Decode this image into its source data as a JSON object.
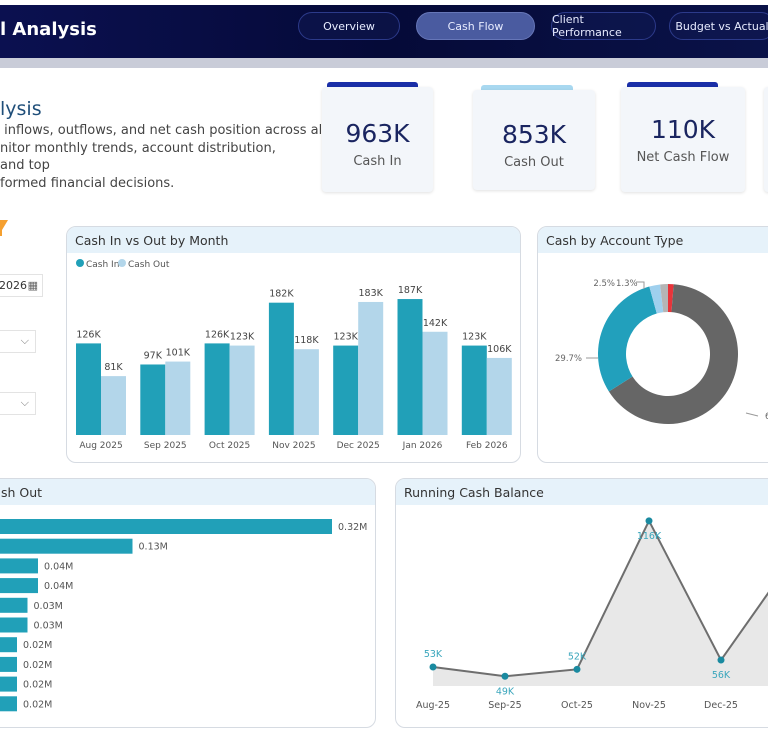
{
  "header": {
    "title": "l Analysis",
    "tabs": [
      {
        "label": "Overview"
      },
      {
        "label": "Cash Flow",
        "active": true
      },
      {
        "label": "Client Performance"
      },
      {
        "label": "Budget vs Actual"
      }
    ]
  },
  "intro": {
    "heading": "lysis",
    "lines": [
      " inflows, outflows, and net cash position across all",
      "nitor monthly trends, account distribution, and top",
      "formed financial decisions."
    ]
  },
  "kpis": [
    {
      "value": "963K",
      "label": "Cash In",
      "accent": "#1a2fa8"
    },
    {
      "value": "853K",
      "label": "Cash Out",
      "accent": "#a8d8f0"
    },
    {
      "value": "110K",
      "label": "Net Cash Flow",
      "accent": "#1a2fa8"
    }
  ],
  "filters": {
    "date_value": "2026",
    "icons": [
      "filter-icon",
      "calendar-icon",
      "chevron-down-icon"
    ]
  },
  "colors": {
    "cash_in": "#21a0b8",
    "cash_out": "#b3d6ea",
    "line": "#6e6e6e",
    "marker": "#1a8aa0",
    "area": "#e8e8e8"
  },
  "chart_data": [
    {
      "type": "bar",
      "title": "Cash In vs Out by Month",
      "categories": [
        "Aug 2025",
        "Sep 2025",
        "Oct 2025",
        "Nov 2025",
        "Dec 2025",
        "Jan 2026",
        "Feb 2026"
      ],
      "series": [
        {
          "name": "Cash In",
          "values": [
            126,
            97,
            126,
            182,
            123,
            187,
            123
          ],
          "labels": [
            "126K",
            "97K",
            "126K",
            "182K",
            "123K",
            "187K",
            "123K"
          ]
        },
        {
          "name": "Cash Out",
          "values": [
            81,
            101,
            123,
            118,
            183,
            142,
            106
          ],
          "labels": [
            "81K",
            "101K",
            "123K",
            "118K",
            "183K",
            "142K",
            "106K"
          ]
        }
      ],
      "legend": "top-left",
      "unit": "K"
    },
    {
      "type": "pie",
      "title": "Cash by Account Type",
      "donut": true,
      "slices": [
        {
          "label": "1.3%",
          "value": 1.3,
          "color": "#e8343a"
        },
        {
          "label": "64.7",
          "value": 64.7,
          "color": "#666666"
        },
        {
          "label": "29.7%",
          "value": 29.7,
          "color": "#22a0bc"
        },
        {
          "label": "2.5%",
          "value": 2.5,
          "color": "#9fd0ee"
        },
        {
          "label": "",
          "value": 1.8,
          "color": "#b5b5b5"
        }
      ]
    },
    {
      "type": "bar",
      "orientation": "horizontal",
      "title": "sh Out",
      "values": [
        0.32,
        0.13,
        0.04,
        0.04,
        0.03,
        0.03,
        0.02,
        0.02,
        0.02,
        0.02
      ],
      "labels": [
        "0.32M",
        "0.13M",
        "0.04M",
        "0.04M",
        "0.03M",
        "0.03M",
        "0.02M",
        "0.02M",
        "0.02M",
        "0.02M"
      ]
    },
    {
      "type": "area",
      "title": "Running Cash Balance",
      "categories": [
        "Aug-25",
        "Sep-25",
        "Oct-25",
        "Nov-25",
        "Dec-25"
      ],
      "values": [
        53,
        49,
        52,
        116,
        56
      ],
      "labels": [
        "53K",
        "49K",
        "52K",
        "116K",
        "56K"
      ]
    }
  ]
}
